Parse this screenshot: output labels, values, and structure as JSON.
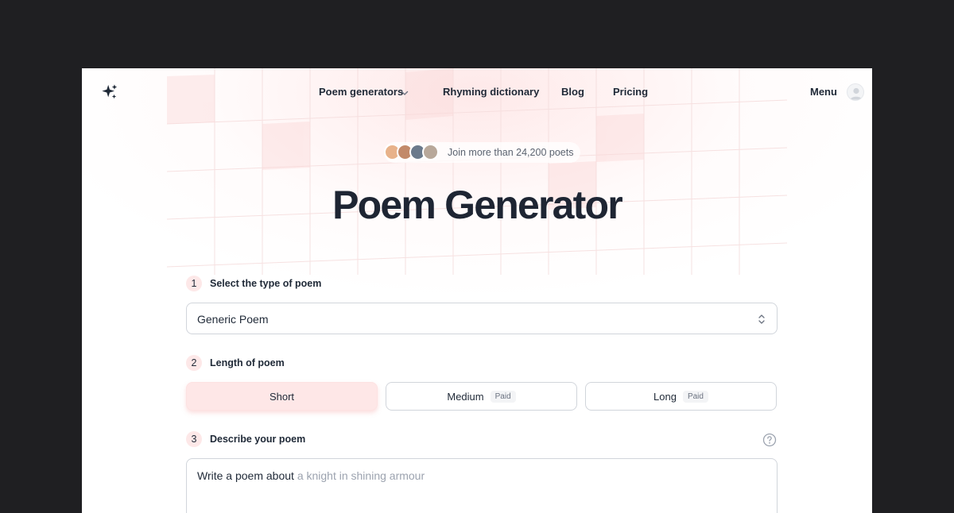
{
  "nav": {
    "logo_icon": "sparkles-icon",
    "links": [
      {
        "label": "Poem generators",
        "has_dropdown": true
      },
      {
        "label": "Rhyming dictionary"
      },
      {
        "label": "Blog"
      },
      {
        "label": "Pricing"
      }
    ],
    "menu_label": "Menu",
    "avatar_icon": "user-avatar-icon"
  },
  "social_proof": {
    "text": "Join more than 24,200 poets",
    "avatar_count": 4
  },
  "hero": {
    "title": "Poem Generator"
  },
  "steps": [
    {
      "number": "1",
      "label": "Select the type of poem"
    },
    {
      "number": "2",
      "label": "Length of poem"
    },
    {
      "number": "3",
      "label": "Describe your poem"
    }
  ],
  "poem_type": {
    "selected": "Generic Poem"
  },
  "length_options": [
    {
      "label": "Short",
      "badge": "",
      "selected": true
    },
    {
      "label": "Medium",
      "badge": "Paid",
      "selected": false
    },
    {
      "label": "Long",
      "badge": "Paid",
      "selected": false
    }
  ],
  "description": {
    "prefix": "Write a poem about",
    "placeholder": "a knight in shining armour"
  },
  "colors": {
    "accent": "#fee7e7",
    "title": "#1e2533",
    "backdrop": "#1f1f22"
  }
}
